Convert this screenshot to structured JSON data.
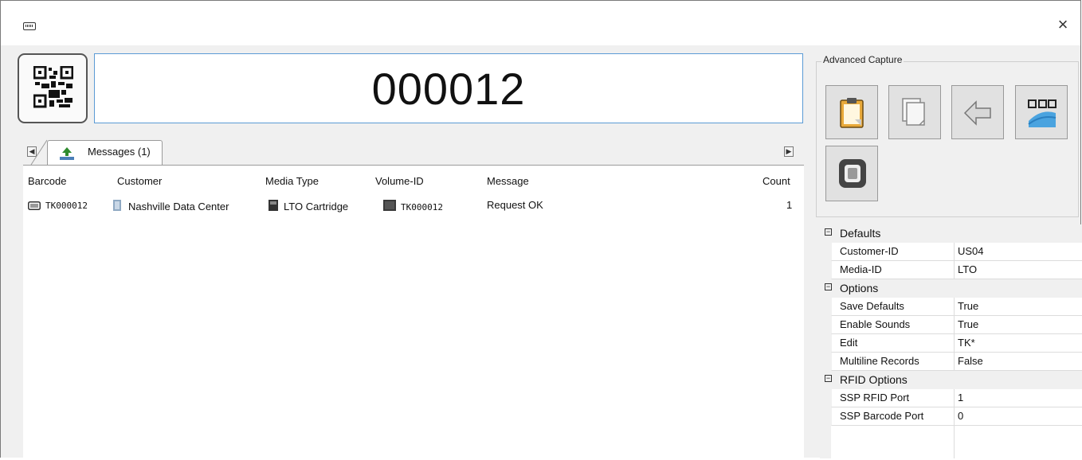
{
  "window": {
    "close_glyph": "×"
  },
  "scan": {
    "value": "000012"
  },
  "tabs": [
    {
      "label": "Messages (1)"
    }
  ],
  "table": {
    "headers": [
      "Barcode",
      "Customer",
      "Media Type",
      "Volume-ID",
      "Message",
      "Count"
    ],
    "rows": [
      {
        "barcode": "TK000012",
        "customer": "Nashville Data Center",
        "media_type": "LTO Cartridge",
        "volume_id": "TK000012",
        "message": "Request OK",
        "count": "1"
      }
    ]
  },
  "advanced": {
    "title": "Advanced Capture",
    "buttons": [
      {
        "icon": "clipboard-icon"
      },
      {
        "icon": "copy-pages-icon"
      },
      {
        "icon": "arrow-left-icon"
      },
      {
        "icon": "qr-barcode-icon"
      },
      {
        "icon": "rfid-chip-icon"
      }
    ]
  },
  "properties": {
    "categories": [
      {
        "label": "Defaults",
        "items": [
          {
            "name": "Customer-ID",
            "value": "US04"
          },
          {
            "name": "Media-ID",
            "value": "LTO"
          }
        ]
      },
      {
        "label": "Options",
        "items": [
          {
            "name": "Save Defaults",
            "value": "True"
          },
          {
            "name": "Enable Sounds",
            "value": "True"
          },
          {
            "name": "Edit",
            "value": "TK*"
          },
          {
            "name": "Multiline Records",
            "value": "False"
          }
        ]
      },
      {
        "label": "RFID Options",
        "items": [
          {
            "name": "SSP RFID Port",
            "value": "1"
          },
          {
            "name": "SSP Barcode Port",
            "value": "0"
          }
        ]
      }
    ]
  },
  "colors": {
    "field_border": "#5b9bd5",
    "panel_bg": "#f0f0f0"
  }
}
